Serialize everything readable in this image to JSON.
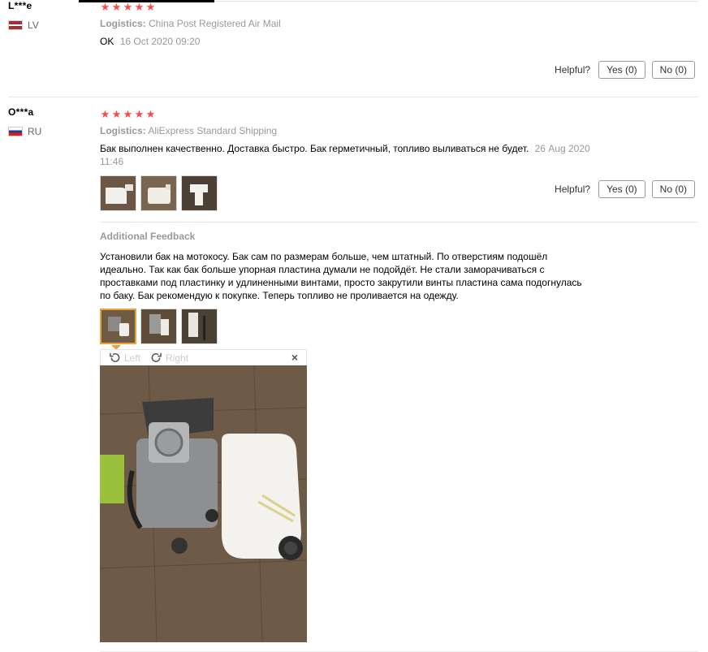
{
  "reviews": [
    {
      "user": "L***e",
      "country": "LV",
      "stars": 5,
      "logistics_label": "Logistics:",
      "logistics_value": "China Post Registered Air Mail",
      "text": "OK",
      "date": "16 Oct 2020 09:20",
      "helpful_label": "Helpful?",
      "yes_label": "Yes (0)",
      "no_label": "No (0)"
    },
    {
      "user": "O***a",
      "country": "RU",
      "stars": 5,
      "logistics_label": "Logistics:",
      "logistics_value": "AliExpress Standard Shipping",
      "text": "Бак выполнен качественно. Доставка быстро. Бак герметичный, топливо выливаться не будет.",
      "date_part1": "26 Aug 2020",
      "date_part2": "11:46",
      "helpful_label": "Helpful?",
      "yes_label": "Yes (0)",
      "no_label": "No (0)",
      "additional_feedback_title": "Additional Feedback",
      "additional_feedback_text": "Установили бак на мотокосу. Бак сам по размерам больше, чем штатный. По отверстиям подошёл идеально. Так как бак больше упорная пластина думали не подойдёт. Не стали заморачиваться с проставками под пластинку и удлиненными винтами, просто закрутили винты пластина сама подогнулась по баку. Бак рекомендую к покупке. Теперь топливо не проливается на одежду."
    }
  ],
  "viewer": {
    "rotate_left_label": "Left",
    "rotate_right_label": "Right",
    "close_symbol": "×"
  },
  "icons": {
    "star": "star-icon",
    "rotate_left": "rotate-left-icon",
    "rotate_right": "rotate-right-icon",
    "close": "close-icon"
  },
  "colors": {
    "star": "#ff4747",
    "selected_thumb_border": "#e8a33d"
  }
}
